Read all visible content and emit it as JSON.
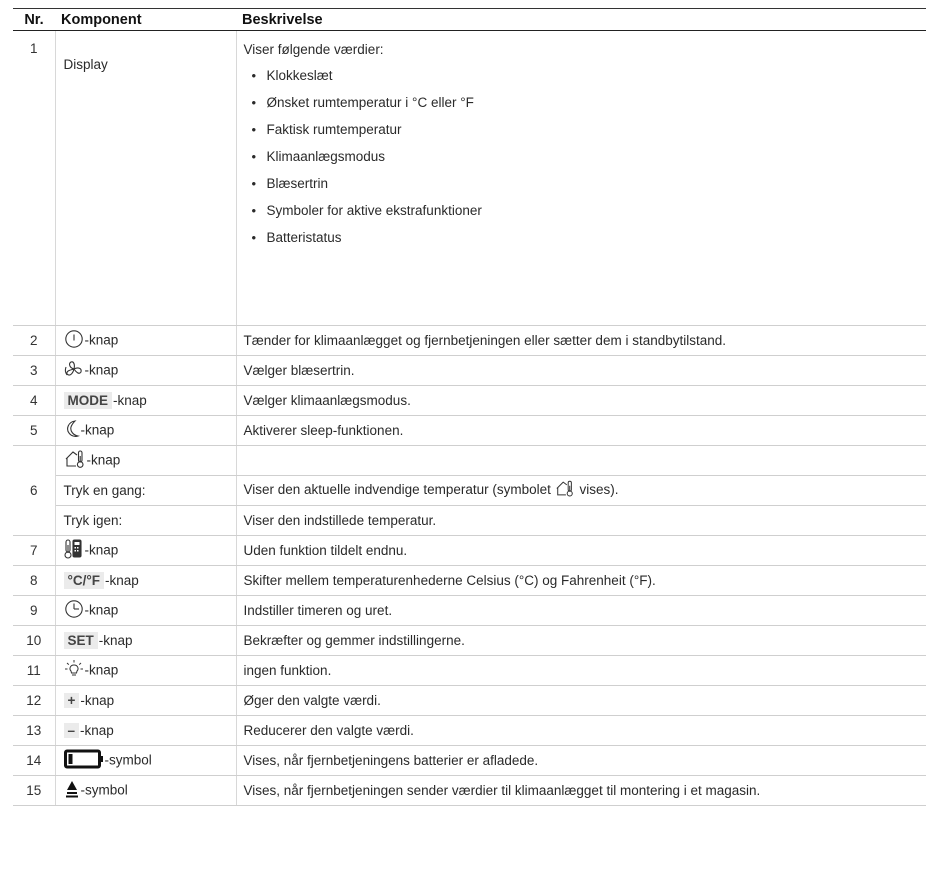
{
  "headers": {
    "nr": "Nr.",
    "component": "Komponent",
    "description": "Beskrivelse"
  },
  "rows": [
    {
      "nr": "1",
      "component": "Display",
      "description": "Viser følgende værdier:",
      "bullets": [
        "Klokkeslæt",
        "Ønsket rumtemperatur i °C eller °F",
        "Faktisk rumtemperatur",
        "Klimaanlægsmodus",
        "Blæsertrin",
        "Symboler for aktive ekstrafunktioner",
        "Batteristatus"
      ]
    },
    {
      "nr": "2",
      "icon": "power-icon",
      "suffix": "-knap",
      "description": "Tænder for klimaanlægget og fjernbetjeningen eller sætter dem i standbytilstand."
    },
    {
      "nr": "3",
      "icon": "fan-icon",
      "suffix": "-knap",
      "description": "Vælger blæsertrin."
    },
    {
      "nr": "4",
      "key": "MODE",
      "suffix": "-knap",
      "description": "Vælger klimaanlægsmodus."
    },
    {
      "nr": "5",
      "icon": "moon-icon",
      "suffix": "-knap",
      "description": "Aktiverer sleep-funktionen."
    },
    {
      "nr": "6",
      "icon": "indoor-temp-icon",
      "suffix": "-knap",
      "sub": [
        {
          "label": "Tryk en gang:",
          "description_pre": "Viser den aktuelle indvendige temperatur (symbolet ",
          "description_post": " vises)."
        },
        {
          "label": "Tryk igen:",
          "description": "Viser den indstillede temperatur."
        }
      ]
    },
    {
      "nr": "7",
      "icon": "thermometer-remote-icon",
      "suffix": "-knap",
      "description": "Uden funktion tildelt endnu."
    },
    {
      "nr": "8",
      "key": "°C/°F",
      "suffix": "-knap",
      "description": "Skifter mellem temperaturenhederne Celsius (°C) og Fahrenheit (°F)."
    },
    {
      "nr": "9",
      "icon": "timer-clock-icon",
      "suffix": "-knap",
      "description": "Indstiller timeren og uret."
    },
    {
      "nr": "10",
      "key": "SET",
      "suffix": "-knap",
      "description": "Bekræfter og gemmer indstillingerne."
    },
    {
      "nr": "11",
      "icon": "light-bulb-icon",
      "suffix": "-knap",
      "description": "ingen funktion."
    },
    {
      "nr": "12",
      "key": "+",
      "suffix": "-knap",
      "description": "Øger den valgte værdi."
    },
    {
      "nr": "13",
      "key": "–",
      "suffix": "-knap",
      "description": "Reducerer den valgte værdi."
    },
    {
      "nr": "14",
      "icon": "battery-empty-icon",
      "suffix": "-symbol",
      "description": "Vises, når fjernbetjeningens batterier er afladede."
    },
    {
      "nr": "15",
      "icon": "transmit-icon",
      "suffix": "-symbol",
      "description": "Vises, når fjernbetjeningen sender værdier til klimaanlægget til montering i et magasin."
    }
  ]
}
